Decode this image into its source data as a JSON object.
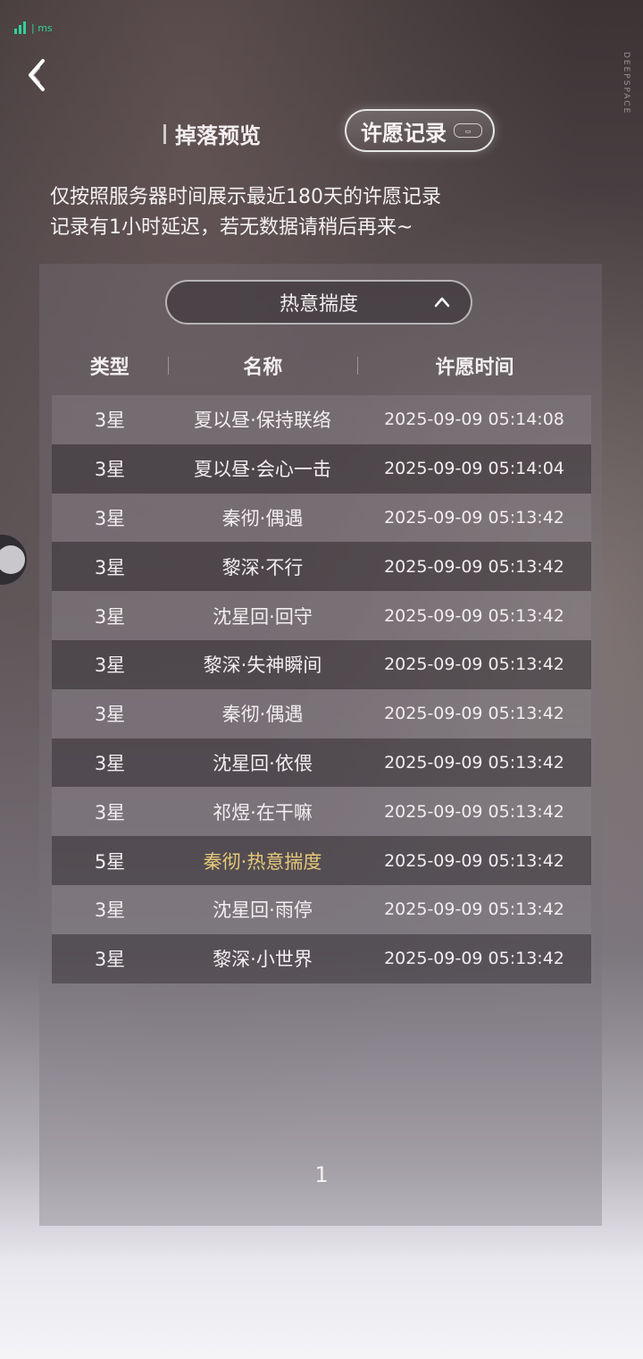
{
  "status": {
    "signal_text": "| ms"
  },
  "brand": {
    "text": "DEEPSPACE"
  },
  "tabs": [
    {
      "label": "掉落预览",
      "active": false
    },
    {
      "label": "许愿记录",
      "active": true
    }
  ],
  "notice": {
    "line1": "仅按照服务器时间展示最近180天的许愿记录",
    "line2": "记录有1小时延迟，若无数据请稍后再来~"
  },
  "filter": {
    "selected": "热意揣度"
  },
  "table": {
    "headers": [
      "类型",
      "名称",
      "许愿时间"
    ],
    "rows": [
      {
        "type": "3星",
        "name": "夏以昼·保持联络",
        "time": "2025-09-09 05:14:08",
        "rarity": 3
      },
      {
        "type": "3星",
        "name": "夏以昼·会心一击",
        "time": "2025-09-09 05:14:04",
        "rarity": 3
      },
      {
        "type": "3星",
        "name": "秦彻·偶遇",
        "time": "2025-09-09 05:13:42",
        "rarity": 3
      },
      {
        "type": "3星",
        "name": "黎深·不行",
        "time": "2025-09-09 05:13:42",
        "rarity": 3
      },
      {
        "type": "3星",
        "name": "沈星回·回守",
        "time": "2025-09-09 05:13:42",
        "rarity": 3
      },
      {
        "type": "3星",
        "name": "黎深·失神瞬间",
        "time": "2025-09-09 05:13:42",
        "rarity": 3
      },
      {
        "type": "3星",
        "name": "秦彻·偶遇",
        "time": "2025-09-09 05:13:42",
        "rarity": 3
      },
      {
        "type": "3星",
        "name": "沈星回·依偎",
        "time": "2025-09-09 05:13:42",
        "rarity": 3
      },
      {
        "type": "3星",
        "name": "祁煜·在干嘛",
        "time": "2025-09-09 05:13:42",
        "rarity": 3
      },
      {
        "type": "5星",
        "name": "秦彻·热意揣度",
        "time": "2025-09-09 05:13:42",
        "rarity": 5
      },
      {
        "type": "3星",
        "name": "沈星回·雨停",
        "time": "2025-09-09 05:13:42",
        "rarity": 3
      },
      {
        "type": "3星",
        "name": "黎深·小世界",
        "time": "2025-09-09 05:13:42",
        "rarity": 3
      }
    ]
  },
  "pagination": {
    "page": "1"
  },
  "colors": {
    "five_star": "#e6c878",
    "status_green": "#2fd29a"
  },
  "icons": {
    "back": "back-arrow-icon",
    "dropdown": "chevron-up-icon",
    "signal": "signal-bars-icon"
  }
}
